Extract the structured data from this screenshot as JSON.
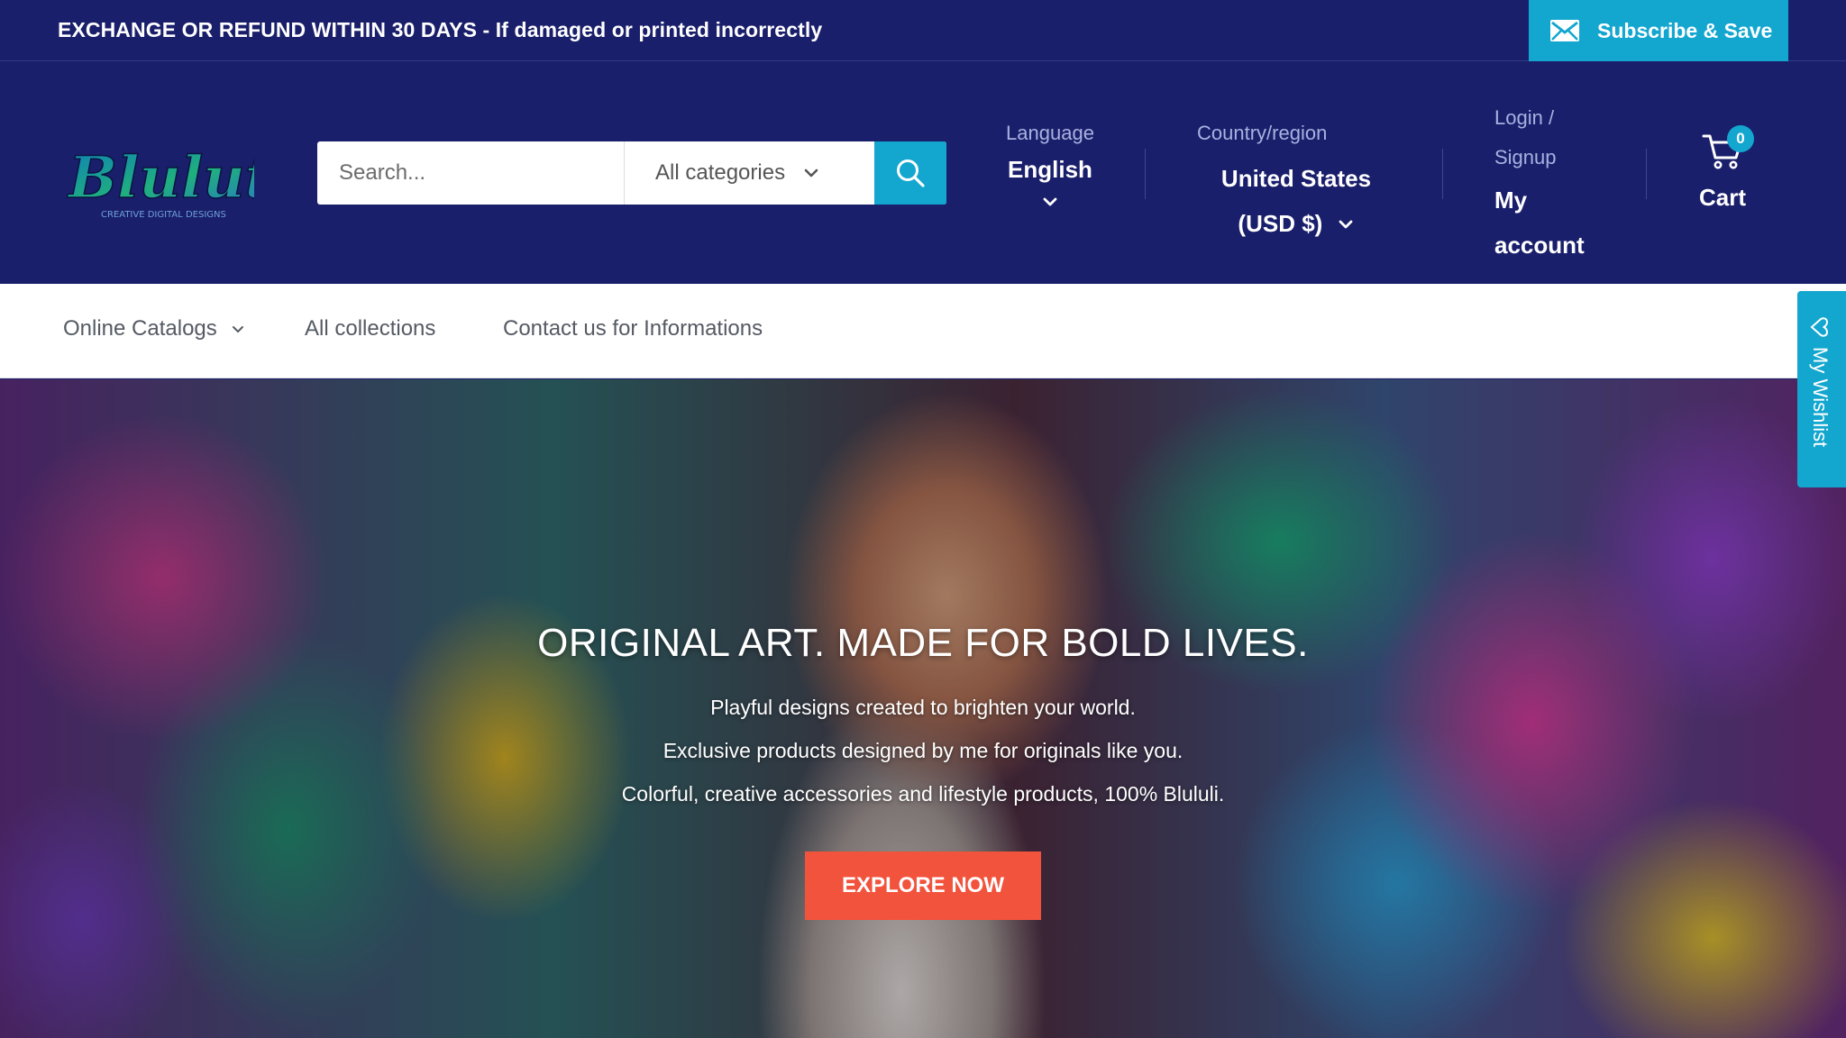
{
  "announcement": {
    "text": "EXCHANGE OR REFUND WITHIN 30 DAYS - If damaged or printed incorrectly",
    "subscribe_label": "Subscribe & Save"
  },
  "header": {
    "logo_text": "Bluluti",
    "logo_tagline": "CREATIVE DIGITAL DESIGNS",
    "search_placeholder": "Search...",
    "category_label": "All categories",
    "language_label": "Language",
    "language_value": "English",
    "country_label": "Country/region",
    "country_value": "United States",
    "currency_value": "(USD $)",
    "login_label": "Login /",
    "signup_label": "Signup",
    "account_label_1": "My",
    "account_label_2": "account",
    "cart_count": "0",
    "cart_label": "Cart"
  },
  "nav": {
    "items": [
      {
        "label": "Online Catalogs"
      },
      {
        "label": "All collections"
      },
      {
        "label": "Contact us for Informations"
      }
    ]
  },
  "hero": {
    "title": "ORIGINAL ART. MADE FOR BOLD LIVES.",
    "line1": "Playful designs created to brighten your world.",
    "line2": "Exclusive products designed by me for originals like you.",
    "line3": "Colorful, creative accessories and lifestyle products, 100% Blululi.",
    "cta_label": "EXPLORE NOW"
  },
  "wishlist": {
    "label": "My Wishlist"
  },
  "colors": {
    "header_bg": "#1a1f6b",
    "accent": "#13a6cf",
    "cta": "#f2533c"
  },
  "icons": [
    "mail-icon",
    "chevron-down-icon",
    "search-icon",
    "cart-icon",
    "heart-icon"
  ]
}
